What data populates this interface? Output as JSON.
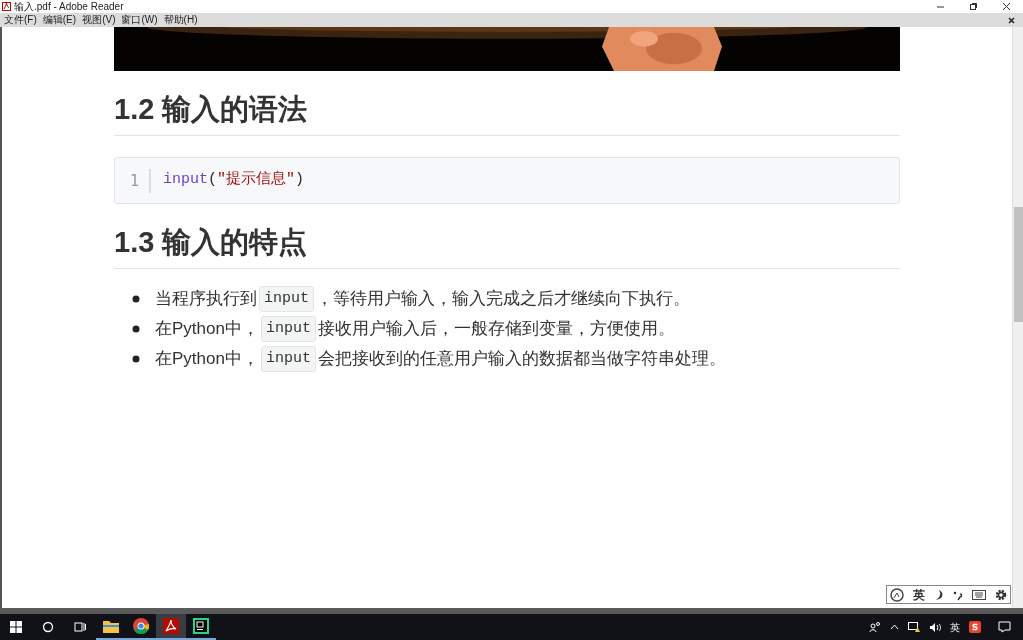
{
  "window": {
    "title": "输入.pdf - Adobe Reader"
  },
  "menu": [
    "文件(F)",
    "编辑(E)",
    "视图(V)",
    "窗口(W)",
    "帮助(H)"
  ],
  "document": {
    "sections": [
      {
        "heading": "1.2 输入的语法",
        "code": {
          "line_number": "1",
          "tokens": [
            {
              "kind": "function",
              "text": "input"
            },
            {
              "kind": "punct",
              "text": "("
            },
            {
              "kind": "string",
              "text": "\"提示信息\""
            },
            {
              "kind": "punct",
              "text": ")"
            }
          ]
        }
      },
      {
        "heading": "1.3 输入的特点",
        "bullets": [
          {
            "parts": [
              {
                "kind": "text",
                "text": "当程序执行到"
              },
              {
                "kind": "code",
                "text": "input"
              },
              {
                "kind": "text",
                "text": "，等待用户输入，输入完成之后才继续向下执行。"
              }
            ]
          },
          {
            "parts": [
              {
                "kind": "text",
                "text": "在Python中，"
              },
              {
                "kind": "code",
                "text": "input"
              },
              {
                "kind": "text",
                "text": "接收用户输入后，一般存储到变量，方便使用。"
              }
            ]
          },
          {
            "parts": [
              {
                "kind": "text",
                "text": "在Python中，"
              },
              {
                "kind": "code",
                "text": "input"
              },
              {
                "kind": "text",
                "text": "会把接收到的任意用户输入的数据都当做字符串处理。"
              }
            ]
          }
        ]
      }
    ]
  },
  "ime_toolbar": {
    "mode": "英"
  },
  "taskbar": {
    "apps": [
      {
        "kind": "explorer",
        "selected": false
      },
      {
        "kind": "chrome",
        "selected": false
      },
      {
        "kind": "reader",
        "selected": true
      },
      {
        "kind": "pycharm",
        "selected": false
      }
    ],
    "tray": {
      "ime": "英"
    }
  }
}
